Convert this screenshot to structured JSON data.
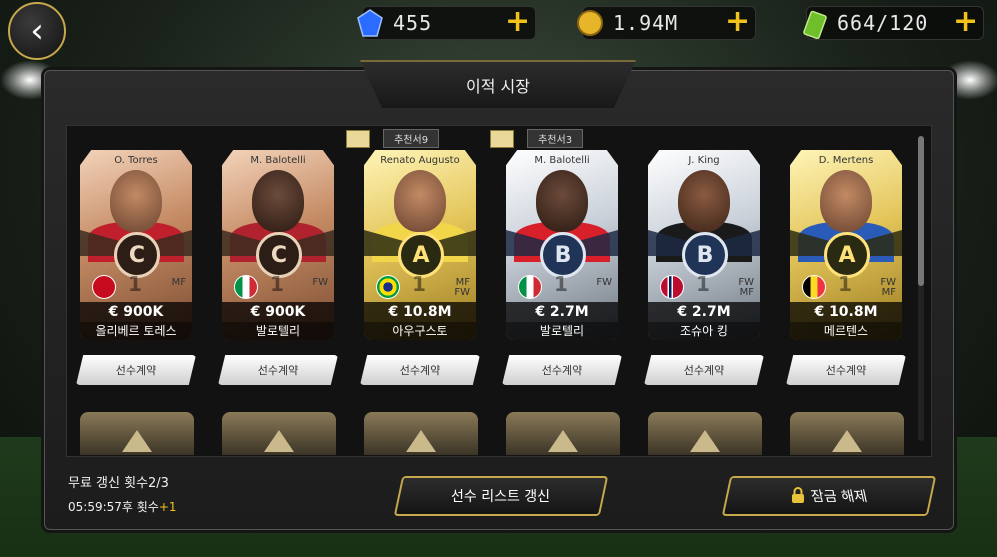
{
  "currency": {
    "gems": {
      "value": "455",
      "icon": "blue-gem-icon"
    },
    "coins": {
      "value": "1.94M",
      "icon": "gold-coin-icon"
    },
    "energy": {
      "value": "664/120",
      "icon": "green-battery-icon"
    },
    "plus": "+"
  },
  "back_icon": "‹",
  "title": "이적 시장",
  "players": [
    {
      "card_name": "O. Torres",
      "grade": "C",
      "tier": "bronze",
      "level": "1",
      "position": "MF",
      "price": "€ 900K",
      "korean_name": "올리베르 토레스",
      "flag_color": "#c60b1e"
    },
    {
      "card_name": "M. Balotelli",
      "grade": "C",
      "tier": "bronze",
      "level": "1",
      "position": "FW",
      "price": "€ 900K",
      "korean_name": "발로텔리",
      "flag_color": "#009246"
    },
    {
      "card_name": "Renato Augusto",
      "grade": "A",
      "tier": "gold",
      "level": "1",
      "position": "MF\nFW",
      "price": "€ 10.8M",
      "korean_name": "아우구스토",
      "flag_color": "#009c3b",
      "recommend": "추천서9"
    },
    {
      "card_name": "M. Balotelli",
      "grade": "B",
      "tier": "silver",
      "level": "1",
      "position": "FW",
      "price": "€ 2.7M",
      "korean_name": "발로텔리",
      "flag_color": "#009246",
      "recommend": "추천서3"
    },
    {
      "card_name": "J. King",
      "grade": "B",
      "tier": "silver",
      "level": "1",
      "position": "FW\nMF",
      "price": "€ 2.7M",
      "korean_name": "조슈아 킹",
      "flag_color": "#ba0c2f"
    },
    {
      "card_name": "D. Mertens",
      "grade": "A",
      "tier": "gold",
      "level": "1",
      "position": "FW\nMF",
      "price": "€ 10.8M",
      "korean_name": "메르텐스",
      "flag_color": "#fdda24"
    }
  ],
  "sign_label": "선수계약",
  "free_refresh": "무료 갱신 횟수2/3",
  "timer": {
    "text": "05:59:57후 횟수",
    "plus": "+1"
  },
  "refresh_button": "선수 리스트 갱신",
  "unlock_button": "잠금 해제"
}
